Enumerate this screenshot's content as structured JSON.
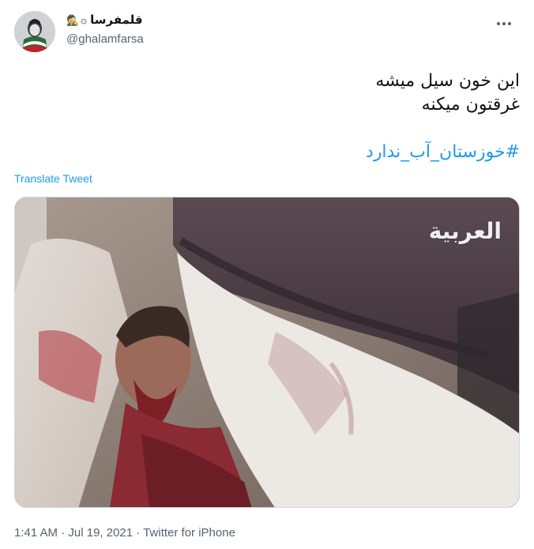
{
  "tweet": {
    "display_name": "قلمفرسا",
    "name_emojis": "🕵☼",
    "handle": "@ghalamfarsa",
    "text_lines": [
      "این خون سیل میشه",
      "غرقتون میکنه"
    ],
    "hashtag": "#خوزستان_آب_ندارد",
    "translate_label": "Translate Tweet",
    "media": {
      "watermark": "العربية"
    },
    "time": "1:41 AM",
    "date": "Jul 19, 2021",
    "source": "Twitter for iPhone",
    "separator": "·"
  },
  "colors": {
    "link": "#1d9bf0",
    "secondary_text": "#536471",
    "primary_text": "#0f1419"
  },
  "icons": {
    "more": "more-dots-icon"
  }
}
